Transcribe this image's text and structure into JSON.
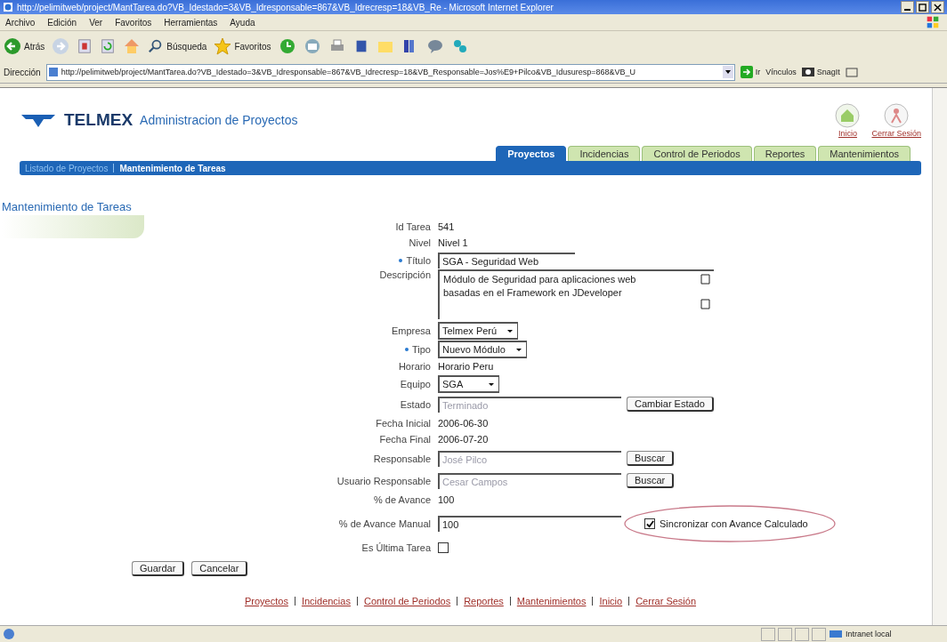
{
  "window": {
    "title": "http://pelimitweb/project/MantTarea.do?VB_Idestado=3&VB_Idresponsable=867&VB_Idrecresp=18&VB_Re - Microsoft Internet Explorer"
  },
  "menu": [
    "Archivo",
    "Edición",
    "Ver",
    "Favoritos",
    "Herramientas",
    "Ayuda"
  ],
  "toolbar": [
    {
      "kind": "back",
      "label": "Atrás"
    },
    {
      "kind": "forward"
    },
    {
      "kind": "stop"
    },
    {
      "kind": "refresh"
    },
    {
      "kind": "home"
    },
    {
      "kind": "search",
      "label": "Búsqueda"
    },
    {
      "kind": "favorites",
      "label": "Favoritos"
    },
    {
      "kind": "history"
    },
    {
      "kind": "mail"
    },
    {
      "kind": "print"
    },
    {
      "kind": "edit"
    },
    {
      "kind": "folder"
    },
    {
      "kind": "research"
    },
    {
      "kind": "messenger"
    },
    {
      "kind": "plugin"
    }
  ],
  "address": {
    "label": "Dirección",
    "url": "http://pelimitweb/project/MantTarea.do?VB_Idestado=3&VB_Idresponsable=867&VB_Idrecresp=18&VB_Responsable=Jos%E9+Pilco&VB_Idusuresp=868&VB_U",
    "go": "Ir",
    "links": "Vínculos",
    "snagit": "SnagIt"
  },
  "page": {
    "brand": "TELMEX",
    "app_title": "Administracion de Proyectos",
    "header_links": [
      {
        "kind": "home",
        "label": "Inicio"
      },
      {
        "kind": "logout",
        "label": "Cerrar Sesión"
      }
    ],
    "tabs": [
      {
        "label": "Proyectos",
        "selected": true
      },
      {
        "label": "Incidencias",
        "selected": false
      },
      {
        "label": "Control de Periodos",
        "selected": false
      },
      {
        "label": "Reportes",
        "selected": false
      },
      {
        "label": "Mantenimientos",
        "selected": false
      }
    ],
    "breadcrumb": [
      {
        "label": "Listado de Proyectos",
        "selected": false
      },
      {
        "label": "Mantenimiento de Tareas",
        "selected": true
      }
    ],
    "heading": "Mantenimiento de Tareas",
    "form": [
      {
        "kind": "text",
        "label": "Id Tarea",
        "required": false,
        "value": "541"
      },
      {
        "kind": "text",
        "label": "Nivel",
        "required": false,
        "value": "Nivel 1"
      },
      {
        "kind": "input",
        "label": "Título",
        "required": true,
        "value": "SGA - Seguridad Web"
      },
      {
        "kind": "textarea",
        "label": "Descripción",
        "required": false,
        "value": "Módulo de Seguridad para aplicaciones web basadas en el Framework en JDeveloper"
      },
      {
        "kind": "select",
        "label": "Empresa",
        "required": false,
        "value": "Telmex Perú"
      },
      {
        "kind": "select",
        "label": "Tipo",
        "required": true,
        "value": "Nuevo Módulo"
      },
      {
        "kind": "text",
        "label": "Horario",
        "required": false,
        "value": "Horario Peru"
      },
      {
        "kind": "select",
        "label": "Equipo",
        "required": false,
        "value": "SGA"
      },
      {
        "kind": "input_button",
        "label": "Estado",
        "required": false,
        "value": "Terminado",
        "disabled": true,
        "button": "Cambiar Estado"
      },
      {
        "kind": "text",
        "label": "Fecha Inicial",
        "required": false,
        "value": "2006-06-30"
      },
      {
        "kind": "text",
        "label": "Fecha Final",
        "required": false,
        "value": "2006-07-20"
      },
      {
        "kind": "input_button",
        "label": "Responsable",
        "required": false,
        "value": "José Pilco",
        "disabled": true,
        "button": "Buscar"
      },
      {
        "kind": "input_button",
        "label": "Usuario Responsable",
        "required": false,
        "value": "Cesar Campos",
        "disabled": true,
        "button": "Buscar"
      },
      {
        "kind": "text",
        "label": "% de Avance",
        "required": false,
        "value": "100"
      },
      {
        "kind": "input_check",
        "label": "% de Avance Manual",
        "required": false,
        "value": "100",
        "check_label": "Sincronizar con Avance Calculado",
        "checked": true,
        "highlighted": true
      },
      {
        "kind": "checkbox",
        "label": "Es Última Tarea",
        "required": false,
        "checked": false
      }
    ],
    "buttons": [
      "Guardar",
      "Cancelar"
    ],
    "footer_links": [
      "Proyectos",
      "Incidencias",
      "Control de Periodos",
      "Reportes",
      "Mantenimientos",
      "Inicio",
      "Cerrar Sesión"
    ]
  },
  "status": {
    "zone": "Intranet local"
  }
}
